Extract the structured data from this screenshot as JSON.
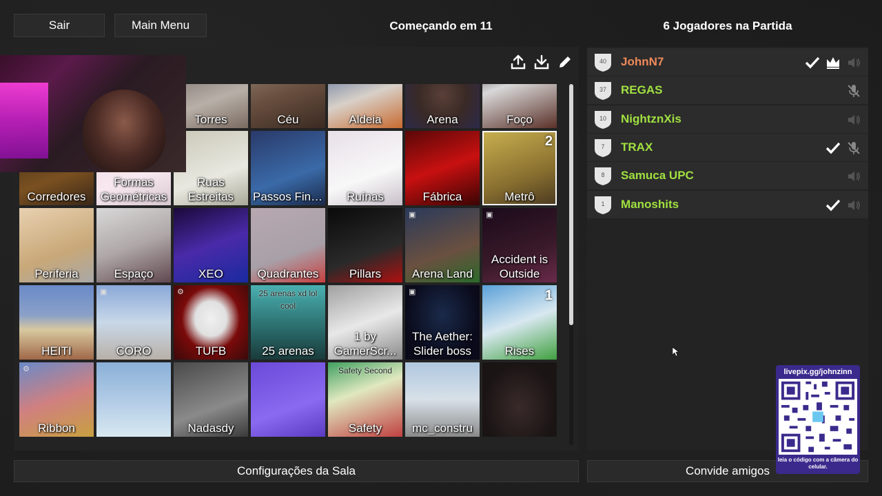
{
  "header": {
    "exit_label": "Sair",
    "main_menu_label": "Main Menu",
    "countdown_text": "Começando em 11",
    "players_count_text": "6 Jogadores na Partida"
  },
  "maps": [
    {
      "label": "Torres",
      "bg": "linear-gradient(160deg,#6a5a5a,#b8b0a8 60%,#7a6a60)"
    },
    {
      "label": "Céu",
      "bg": "linear-gradient(160deg,#9a8a7a,#6a5040 50%,#3a2a22)"
    },
    {
      "label": "Aldeia",
      "bg": "linear-gradient(160deg,#3a5a90,#d8d0c8 55%,#c86a30)"
    },
    {
      "label": "Arena",
      "bg": "radial-gradient(ellipse at 50% 55%,#5a4038 0,#3a2a26 45%,#2a2a50 100%)"
    },
    {
      "label": "Foço",
      "bg": "linear-gradient(160deg,#3a2a2a,#d8d8d8 40%,#5a3028)"
    },
    {
      "label": "Corredores",
      "bg": "linear-gradient(160deg,#3a2a18,#7a5020 60%,#3a2818)"
    },
    {
      "label": "Formas Geométricas",
      "bg": "linear-gradient(160deg,#f0d8e0,#f8e8f0 60%,#d8c8d0)"
    },
    {
      "label": "Ruas Estreitas",
      "bg": "linear-gradient(160deg,#cac8b8,#e8e8e0 60%,#a8a898)"
    },
    {
      "label": "Passos Finos",
      "bg": "linear-gradient(160deg,#2a3a6a,#3a6aa8 60%,#1a2a4a)"
    },
    {
      "label": "Ruínas",
      "bg": "linear-gradient(160deg,#e8e0e8,#f8f8f8 60%,#c8c0c8)"
    },
    {
      "label": "Fábrica",
      "bg": "linear-gradient(160deg,#5a0808,#c81010 50%,#3a0404)"
    },
    {
      "label": "Metrô",
      "bg": "linear-gradient(160deg,#c8b050,#8a7030 60%,#4a3a20)",
      "num": "2",
      "selected": true
    },
    {
      "label": "Periferia",
      "bg": "linear-gradient(160deg,#e8d0b0,#c8a878 60%,#a8a8a8)"
    },
    {
      "label": "Espaço",
      "bg": "linear-gradient(160deg,#d8d8d8,#b0a8a8 50%,#604850)"
    },
    {
      "label": "XEO",
      "bg": "linear-gradient(160deg,#1a0a3a,#4a2aa8 50%,#1a2aa0)"
    },
    {
      "label": "Quadrantes",
      "bg": "linear-gradient(160deg,#b8a8b0,#a8a0a8 60%,#c84040)"
    },
    {
      "label": "Pillars",
      "bg": "linear-gradient(160deg,#0a0a0a,#2a2a2a 60%,#b01010)"
    },
    {
      "label": "Arena Land",
      "bg": "linear-gradient(160deg,#2a3a5a,#6a5040 60%,#2a6a2a)",
      "icon": "m"
    },
    {
      "label": "Accident is Outside",
      "bg": "linear-gradient(160deg,#1a0a1a,#3a1a2a 60%,#6a2a4a)",
      "icon": "m"
    },
    {
      "label": "HEITI",
      "bg": "linear-gradient(180deg,#6a8ac8 0,#8aa0c8 40%,#d8c8a0 60%,#a06848)"
    },
    {
      "label": "CORO",
      "bg": "linear-gradient(180deg,#8aa8d8 0,#c8d8e8 50%,#b8b0a8)",
      "icon": "m"
    },
    {
      "label": "TUFB",
      "bg": "radial-gradient(ellipse at 50% 45%,#f0f0f0 0,#e0e0e0 30%,#7a0a0a 55%,#3a0a0a 100%)",
      "icon": "g"
    },
    {
      "label": "25 arenas",
      "bg": "linear-gradient(180deg,#4ab0b0,#2a6a6a 60%,#1a3a3a)",
      "top_text": "25 arenas xd lol cool"
    },
    {
      "label": "1 by GamerScr...",
      "bg": "linear-gradient(160deg,#a0a0a0,#e8e8e8 50%,#8a8a8a)"
    },
    {
      "label": "The Aether: Slider boss",
      "bg": "radial-gradient(ellipse at 50% 40%,#1a2a4a 0,#0a0a1a 70%)",
      "icon": "m"
    },
    {
      "label": "Rises",
      "bg": "linear-gradient(160deg,#5aa0d8,#d8e8f0 50%,#40a040)",
      "num": "1"
    },
    {
      "label": "Ribbon",
      "bg": "linear-gradient(160deg,#6a8ac8,#d08080 50%,#c8a040)",
      "icon": "g"
    },
    {
      "label": "",
      "bg": "linear-gradient(180deg,#8ab0d8,#b8d0e8 60%,#d8e8f0)"
    },
    {
      "label": "Nadasdy",
      "bg": "linear-gradient(160deg,#4a4a4a,#8a8a8a 60%,#3a3a3a)"
    },
    {
      "label": "",
      "bg": "linear-gradient(160deg,#6a4ad8,#8a6af0 60%,#5a3ac0)"
    },
    {
      "label": "Safety",
      "bg": "linear-gradient(160deg,#40a060,#e0e8c0 40%,#c04040)",
      "top_text": "Safety Second"
    },
    {
      "label": "mc_constru",
      "bg": "linear-gradient(180deg,#b0c8e0,#d8e0e8 50%,#8a8a8a)"
    },
    {
      "label": "",
      "bg": "radial-gradient(ellipse at 50% 60%,#3a2a2a 0,#1a1414 70%)"
    }
  ],
  "players": [
    {
      "name": "JohnN7",
      "level": "40",
      "color": "#f08a5a",
      "check": true,
      "crown": true,
      "mic": "speaker"
    },
    {
      "name": "REGAS",
      "level": "37",
      "color": "#a0e040",
      "check": false,
      "crown": false,
      "mic": "muted"
    },
    {
      "name": "NightznXis",
      "level": "10",
      "color": "#a0e040",
      "check": false,
      "crown": false,
      "mic": "speaker"
    },
    {
      "name": "TRAX",
      "level": "7",
      "color": "#a0e040",
      "check": true,
      "crown": false,
      "mic": "muted"
    },
    {
      "name": "Samuca UPC",
      "level": "8",
      "color": "#a0e040",
      "check": false,
      "crown": false,
      "mic": "speaker"
    },
    {
      "name": "Manoshits",
      "level": "1",
      "color": "#a0e040",
      "check": true,
      "crown": false,
      "mic": "speaker"
    }
  ],
  "footer": {
    "room_settings_label": "Configurações da Sala",
    "invite_friends_label": "Convide amigos"
  },
  "overlay": {
    "qr_title": "livepix.gg/johnzinn",
    "qr_sub": "leia o código com a câmera do celular."
  },
  "toolbar": {
    "icons": [
      "upload-icon",
      "download-icon",
      "edit-icon"
    ]
  }
}
